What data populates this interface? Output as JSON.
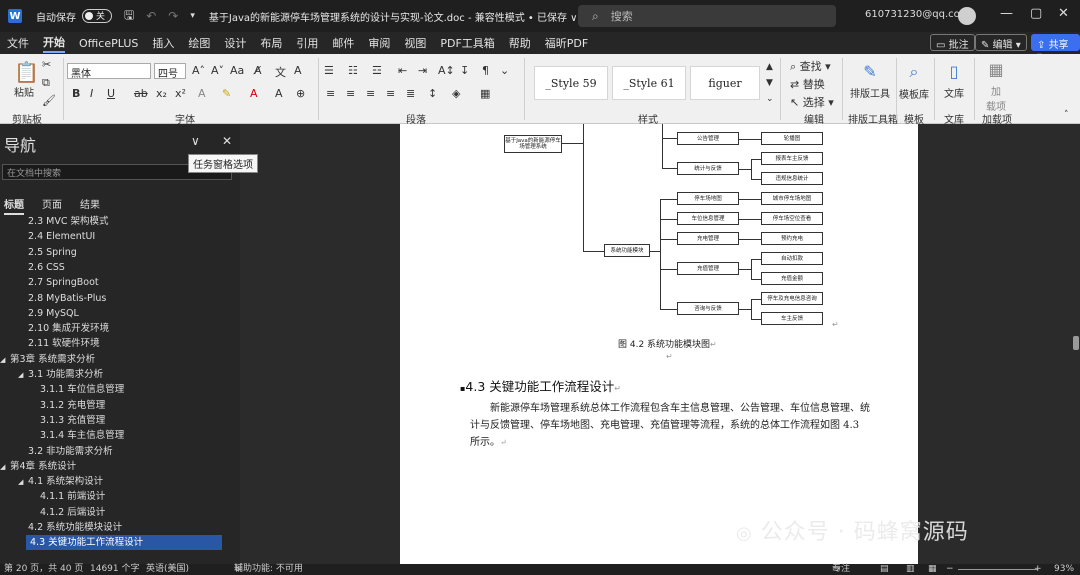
{
  "titlebar": {
    "autosave_label": "自动保存",
    "autosave_state": "关",
    "doc_title": "基于Java的新能源停车场管理系统的设计与实现-论文.doc  -  兼容性模式 • 已保存 ∨",
    "search_placeholder": "搜索",
    "account": "610731230@qq.com"
  },
  "menu": {
    "tabs": [
      "文件",
      "开始",
      "OfficePLUS",
      "插入",
      "绘图",
      "设计",
      "布局",
      "引用",
      "邮件",
      "审阅",
      "视图",
      "PDF工具箱",
      "帮助",
      "福昕PDF"
    ],
    "active": "开始",
    "comment_btn": "批注",
    "edit_btn": "编辑",
    "share_btn": "共享"
  },
  "ribbon": {
    "paste_label": "粘贴",
    "clipboard_group": "剪贴板",
    "font_name": "黑体",
    "font_size": "四号",
    "font_group": "字体",
    "paragraph_group": "段落",
    "styles": [
      "_Style 59",
      "_Style 61",
      "figuer"
    ],
    "styles_group": "样式",
    "find_label": "查找",
    "replace_label": "替换",
    "select_label": "选择",
    "editing_group": "编辑",
    "layout_tool_label": "排版工具",
    "layout_tool_group": "排版工具箱",
    "template_label": "模板库",
    "template_group": "模板",
    "library_label": "文库",
    "library_group": "文库",
    "addin_label": "加\n载项",
    "addin_group": "加载项"
  },
  "nav": {
    "title": "导航",
    "tooltip": "任务窗格选项",
    "search_placeholder": "在文档中搜索",
    "tabs": [
      "标题",
      "页面",
      "结果"
    ],
    "active_tab": "标题",
    "items": [
      {
        "text": "2.3  MVC 架构模式",
        "level": 2
      },
      {
        "text": "2.4  ElementUI",
        "level": 2
      },
      {
        "text": "2.5  Spring",
        "level": 2
      },
      {
        "text": "2.6  CSS",
        "level": 2
      },
      {
        "text": "2.7  SpringBoot",
        "level": 2
      },
      {
        "text": "2.8  MyBatis-Plus",
        "level": 2
      },
      {
        "text": "2.9  MySQL",
        "level": 2
      },
      {
        "text": "2.10  集成开发环境",
        "level": 2
      },
      {
        "text": "2.11  软硬件环境",
        "level": 2
      },
      {
        "text": "第3章  系统需求分析",
        "level": 1,
        "caret": true
      },
      {
        "text": "3.1  功能需求分析",
        "level": 2,
        "caret": true
      },
      {
        "text": "3.1.1  车位信息管理",
        "level": 3
      },
      {
        "text": "3.1.2  充电管理",
        "level": 3
      },
      {
        "text": "3.1.3  充值管理",
        "level": 3
      },
      {
        "text": "3.1.4  车主信息管理",
        "level": 3
      },
      {
        "text": "3.2  非功能需求分析",
        "level": 2
      },
      {
        "text": "第4章  系统设计",
        "level": 1,
        "caret": true
      },
      {
        "text": "4.1  系统架构设计",
        "level": 2,
        "caret": true
      },
      {
        "text": "4.1.1  前端设计",
        "level": 3
      },
      {
        "text": "4.1.2  后端设计",
        "level": 3
      },
      {
        "text": "4.2  系统功能模块设计",
        "level": 2
      },
      {
        "text": "4.3  关键功能工作流程设计",
        "level": 2,
        "selected": true
      }
    ]
  },
  "document": {
    "diagram": {
      "root": "基于Java的新能源停车场管理系统",
      "hub": "系统功能模块",
      "mid": [
        "公告管理",
        "统计与反馈",
        "停车场地图",
        "车位信息管理",
        "充电管理",
        "充值管理",
        "咨询与反馈"
      ],
      "leaf": [
        "轮播图",
        "报表车主反馈",
        "违规信息统计",
        "城市停车场地图",
        "停车场空位查看",
        "预约充电",
        "自动扣款",
        "充值金额",
        "停车及充电信息咨询",
        "车主反馈"
      ]
    },
    "figure_caption": "图 4.2  系统功能模块图",
    "heading": "4.3    关键功能工作流程设计",
    "paragraph": "新能源停车场管理系统总体工作流程包含车主信息管理、公告管理、车位信息管理、统计与反馈管理、停车场地图、充电管理、充值管理等流程，系统的总体工作流程如图 4.3 所示。"
  },
  "watermark": "公众号 · 码蜂窝源码",
  "status": {
    "page": "第 20 页，共 40 页",
    "words": "14691 个字",
    "lang": "英语(美国)",
    "accessibility": "辅助功能: 不可用",
    "focus": "专注",
    "zoom": "93%"
  }
}
